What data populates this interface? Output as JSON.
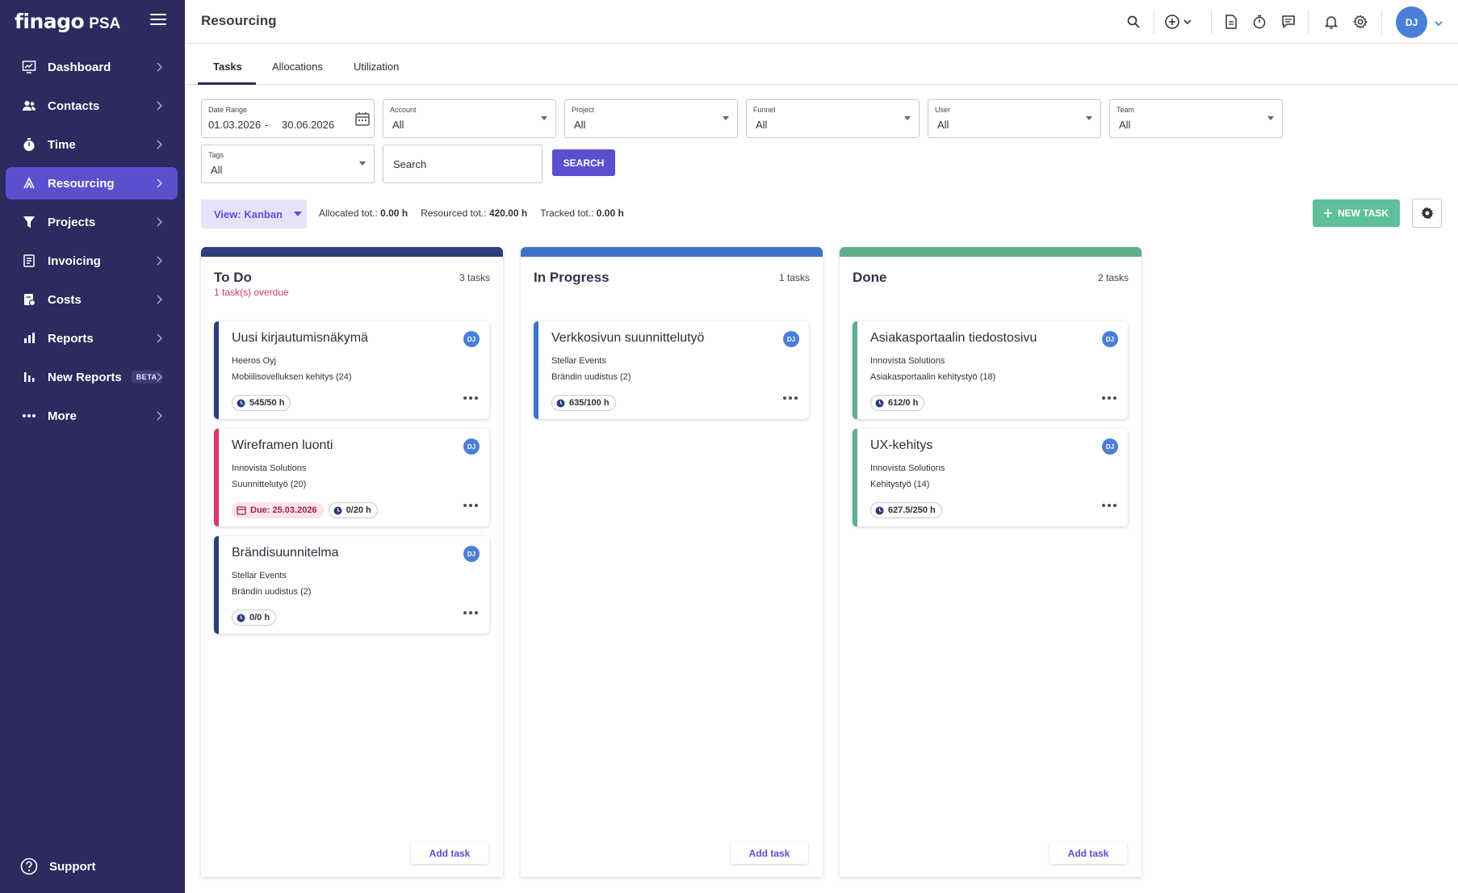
{
  "app": {
    "brand": "finago",
    "product": "PSA"
  },
  "sidebar": {
    "items": [
      {
        "label": "Dashboard"
      },
      {
        "label": "Contacts"
      },
      {
        "label": "Time"
      },
      {
        "label": "Resourcing"
      },
      {
        "label": "Projects"
      },
      {
        "label": "Invoicing"
      },
      {
        "label": "Costs"
      },
      {
        "label": "Reports"
      },
      {
        "label": "New Reports",
        "badge": "BETA"
      },
      {
        "label": "More"
      }
    ],
    "active_item": "Resourcing",
    "support_label": "Support"
  },
  "header": {
    "title": "Resourcing",
    "user_initials": "DJ"
  },
  "tabs": [
    {
      "label": "Tasks",
      "active": true
    },
    {
      "label": "Allocations"
    },
    {
      "label": "Utilization"
    }
  ],
  "filters": {
    "date_range": {
      "label": "Date Range",
      "start": "01.03.2026",
      "separator": "-",
      "end": "30.06.2026"
    },
    "account": {
      "label": "Account",
      "value": "All"
    },
    "project": {
      "label": "Project",
      "value": "All"
    },
    "funnel": {
      "label": "Funnel",
      "value": "All"
    },
    "user": {
      "label": "User",
      "value": "All"
    },
    "team": {
      "label": "Team",
      "value": "All"
    },
    "tags": {
      "label": "Tags",
      "value": "All"
    },
    "search_placeholder": "Search",
    "search_button": "SEARCH"
  },
  "toolbar": {
    "view_label": "View: Kanban",
    "allocated_label": "Allocated tot.:",
    "allocated_value": "0.00 h",
    "resourced_label": "Resourced tot.:",
    "resourced_value": "420.00 h",
    "tracked_label": "Tracked tot.:",
    "tracked_value": "0.00 h",
    "new_task_label": "NEW TASK"
  },
  "columns": [
    {
      "title": "To Do",
      "count": "3 tasks",
      "overdue": "1 task(s) overdue",
      "color": "#2c3e7a",
      "add_label": "Add task",
      "cards": [
        {
          "title": "Uusi kirjautumisnäkymä",
          "account": "Heeros Oyj",
          "project": "Mobiilisovelluksen kehitys (24)",
          "hours": "545/50 h",
          "assignee": "DJ",
          "accent": "#2c3e7a"
        },
        {
          "title": "Wireframen luonti",
          "account": "Innovista Solutions",
          "project": "Suunnittelutyö (20)",
          "due": "Due: 25.03.2026",
          "hours": "0/20 h",
          "assignee": "DJ",
          "accent": "#d6366f"
        },
        {
          "title": "Brändisuunnitelma",
          "account": "Stellar Events",
          "project": "Brändin uudistus (2)",
          "hours": "0/0 h",
          "assignee": "DJ",
          "accent": "#2c3e7a"
        }
      ]
    },
    {
      "title": "In Progress",
      "count": "1 tasks",
      "color": "#3f73c9",
      "add_label": "Add task",
      "cards": [
        {
          "title": "Verkkosivun suunnittelutyö",
          "account": "Stellar Events",
          "project": "Brändin uudistus (2)",
          "hours": "635/100 h",
          "assignee": "DJ",
          "accent": "#3f73c9"
        }
      ]
    },
    {
      "title": "Done",
      "count": "2 tasks",
      "color": "#5fae8c",
      "add_label": "Add task",
      "cards": [
        {
          "title": "Asiakasportaalin tiedostosivu",
          "account": "Innovista Solutions",
          "project": "Asiakasportaalin kehitystyö (18)",
          "hours": "612/0 h",
          "assignee": "DJ",
          "accent": "#5fae8c"
        },
        {
          "title": "UX-kehitys",
          "account": "Innovista Solutions",
          "project": "Kehitystyö (14)",
          "hours": "627.5/250 h",
          "assignee": "DJ",
          "accent": "#5fae8c"
        }
      ]
    }
  ]
}
